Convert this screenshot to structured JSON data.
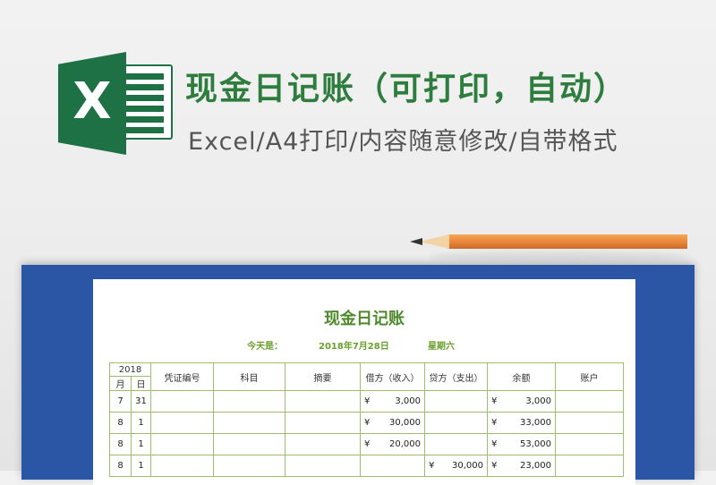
{
  "header": {
    "title": "现金日记账（可打印，自动）",
    "subtitle": "Excel/A4打印/内容随意修改/自带格式"
  },
  "logo": {
    "icon": "excel-icon",
    "letter": "X",
    "color": "#1e7145"
  },
  "sheet": {
    "title": "现金日记账",
    "today_label": "今天是：",
    "date": "2018年7月28日",
    "weekday": "星期六",
    "year": "2018",
    "columns": {
      "month": "月",
      "day": "日",
      "voucher": "凭证编号",
      "subject": "科目",
      "summary": "摘要",
      "debit": "借方（收入）",
      "credit": "贷方（支出）",
      "balance": "余额",
      "account": "账户"
    },
    "rows": [
      {
        "month": "7",
        "day": "31",
        "voucher": "",
        "subject": "",
        "summary": "",
        "debit_yen": "¥",
        "debit": "3,000",
        "credit_yen": "",
        "credit": "",
        "balance_yen": "¥",
        "balance": "3,000",
        "account": ""
      },
      {
        "month": "8",
        "day": "1",
        "voucher": "",
        "subject": "",
        "summary": "",
        "debit_yen": "¥",
        "debit": "30,000",
        "credit_yen": "",
        "credit": "",
        "balance_yen": "¥",
        "balance": "33,000",
        "account": ""
      },
      {
        "month": "8",
        "day": "1",
        "voucher": "",
        "subject": "",
        "summary": "",
        "debit_yen": "¥",
        "debit": "20,000",
        "credit_yen": "",
        "credit": "",
        "balance_yen": "¥",
        "balance": "53,000",
        "account": ""
      },
      {
        "month": "8",
        "day": "1",
        "voucher": "",
        "subject": "",
        "summary": "",
        "debit_yen": "",
        "debit": "",
        "credit_yen": "¥",
        "credit": "30,000",
        "balance_yen": "¥",
        "balance": "23,000",
        "account": ""
      }
    ],
    "colors": {
      "debit": "#27a235",
      "credit": "#d21a1a",
      "balance": "#2a48b5",
      "border": "#9bbf6b",
      "board": "#2b56a5"
    }
  }
}
